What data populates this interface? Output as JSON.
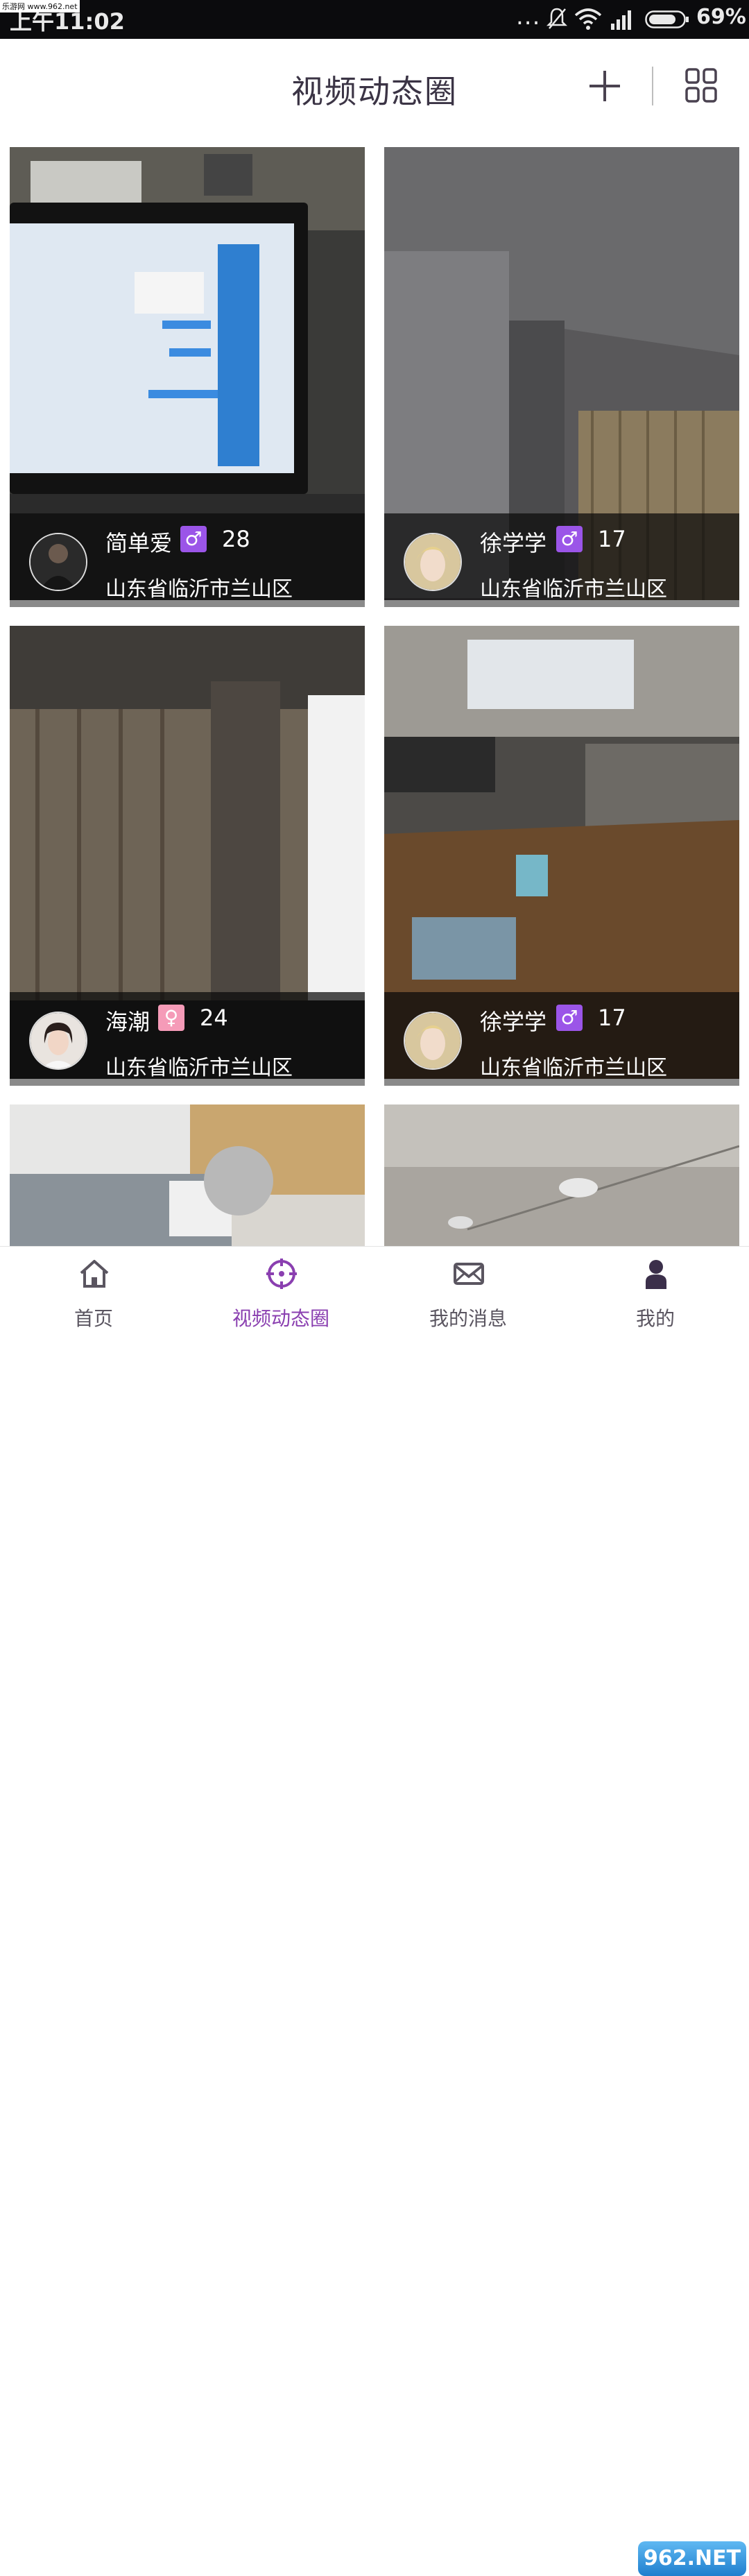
{
  "status_bar": {
    "time": "上午11:02",
    "dots": "...",
    "battery_pct": "69%",
    "watermark": "乐游网 www.962.net"
  },
  "header": {
    "title": "视频动态圈",
    "add_icon": "plus-icon",
    "grid_icon": "grid-icon"
  },
  "colors": {
    "accent": "#8a3fb0",
    "male_badge": "#9b55e8",
    "female_badge": "#f59bb8"
  },
  "cards": [
    {
      "name": "简单爱",
      "gender": "♂",
      "age": "28",
      "location": "山东省临沂市兰山区"
    },
    {
      "name": "徐学学",
      "gender": "♂",
      "age": "17",
      "location": "山东省临沂市兰山区"
    },
    {
      "name": "海潮",
      "gender": "♀",
      "age": "24",
      "location": "山东省临沂市兰山区"
    },
    {
      "name": "徐学学",
      "gender": "♂",
      "age": "17",
      "location": "山东省临沂市兰山区"
    }
  ],
  "bottom_nav": [
    {
      "label": "首页",
      "icon": "home-icon"
    },
    {
      "label": "视频动态圈",
      "icon": "crosshair-icon",
      "active": true
    },
    {
      "label": "我的消息",
      "icon": "mail-icon"
    },
    {
      "label": "我的",
      "icon": "person-icon"
    }
  ],
  "corner_watermark": "962.NET"
}
